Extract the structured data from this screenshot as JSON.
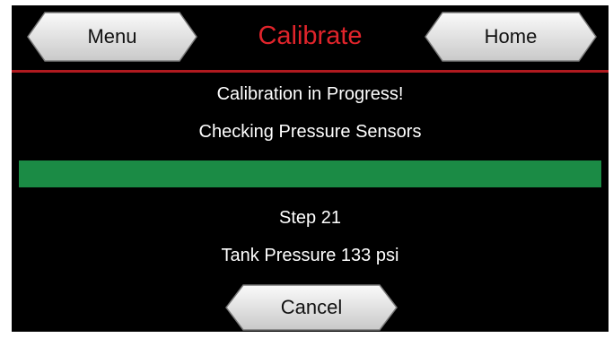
{
  "header": {
    "title": "Calibrate",
    "menu_label": "Menu",
    "home_label": "Home"
  },
  "status": {
    "heading": "Calibration in Progress!",
    "subheading": "Checking Pressure Sensors",
    "progress_fraction": 1.0,
    "step_text": "Step 21",
    "pressure_text": "Tank Pressure 133 psi"
  },
  "actions": {
    "cancel_label": "Cancel"
  },
  "colors": {
    "background": "#000000",
    "title": "#e0242b",
    "header_rule": "#b01a1f",
    "progress": "#1b8b45",
    "button_face": "#e6e6e6",
    "text": "#ffffff"
  }
}
